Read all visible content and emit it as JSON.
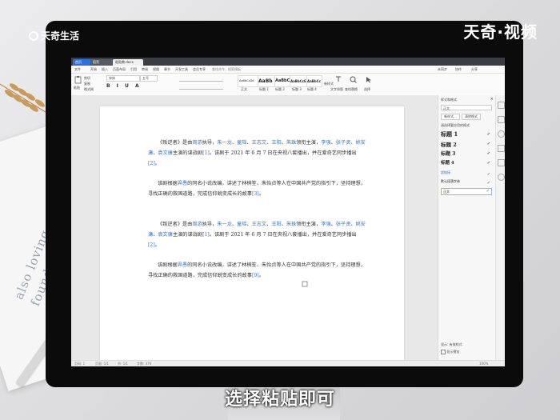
{
  "overlay": {
    "logo_text": "天奇生活",
    "watermark": "天奇·视频",
    "subtitle": "选择粘贴即可"
  },
  "tabs": [
    "首页",
    "稻壳",
    "粘贴教.docx"
  ],
  "menu": [
    "文件",
    "开始",
    "插入",
    "页面布局",
    "引用",
    "审阅",
    "视图",
    "章节",
    "开发工具",
    "会员专享",
    "查找命令、搜索模板"
  ],
  "menu_right": [
    "未同步",
    "协作",
    "分享"
  ],
  "ribbon": {
    "paste": "粘贴",
    "cut": "剪切",
    "copy": "复制",
    "format_painter": "格式刷",
    "font_name": "宋体",
    "font_size": "五号",
    "styles": [
      "AaBbCcDd",
      "AaBb",
      "AaBbC",
      "AaBbCcE",
      "AaBbCc"
    ],
    "style_labels": [
      "正文",
      "标题 1",
      "标题 2",
      "标题 3",
      "标题 4"
    ],
    "new_style": "新样式",
    "text_tool": "文字排版",
    "find_replace": "查找替换",
    "select": "选择"
  },
  "document": {
    "p1": {
      "a": "《叛逆者》是由",
      "director": "周游",
      "b": "执导，",
      "actors": [
        "朱一龙",
        "童瑶",
        "王志文",
        "王阳",
        "朱珠"
      ],
      "c": "领衔主演，",
      "actors2": [
        "李强",
        "张子贤",
        "姚安濂",
        "袁文康"
      ],
      "d": "主演的谍战剧",
      "ref1": "[1]",
      "e": "。该剧于 2021 年 6 月 7 日在央视八套播出，并在爱奇艺同步播出",
      "ref2": "[2]",
      "f": "。"
    },
    "p2": {
      "a": "该剧根据",
      "author": "畀愚",
      "b": "的同名小说改编，讲述了林楠笙、朱怡贞等人在中国共产党的指引下，坚持理想，寻找正确的救国道路，完成信仰蜕变成长的故事",
      "ref": "[3]",
      "c": "。"
    },
    "p3_ref": "[9]"
  },
  "style_pane": {
    "title": "样式和格式",
    "current": "正文",
    "new_style_btn": "新样式...",
    "clear_btn": "清除格式",
    "apply_label": "请选择要应用的格式",
    "headings": [
      "标题 1",
      "标题 2",
      "标题 3",
      "标题 4"
    ],
    "item_link": "超链接",
    "item_default": "默认段落字体",
    "item_body": "正文",
    "show_label": "显示: 有效样式",
    "preview_label": "显示预览"
  },
  "status": {
    "page": "页码: 1",
    "pages": "页面: 1/1",
    "section": "节: 1/1",
    "words": "字数: 376",
    "zoom": "100%"
  }
}
